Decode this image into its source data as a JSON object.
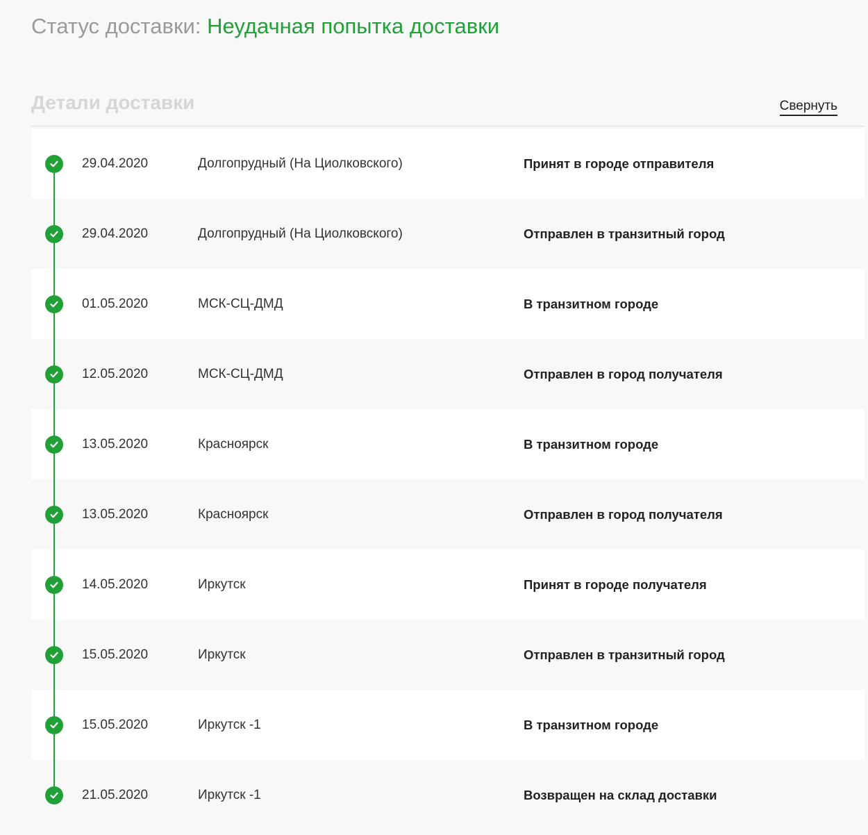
{
  "status": {
    "label": "Статус доставки:",
    "value": "Неудачная попытка доставки"
  },
  "details": {
    "title": "Детали доставки",
    "collapse_label": "Свернуть"
  },
  "timeline": [
    {
      "date": "29.04.2020",
      "place": "Долгопрудный (На Циолковского)",
      "event": "Принят в городе отправителя"
    },
    {
      "date": "29.04.2020",
      "place": "Долгопрудный (На Циолковского)",
      "event": "Отправлен в транзитный город"
    },
    {
      "date": "01.05.2020",
      "place": "МСК-СЦ-ДМД",
      "event": "В транзитном городе"
    },
    {
      "date": "12.05.2020",
      "place": "МСК-СЦ-ДМД",
      "event": "Отправлен в город получателя"
    },
    {
      "date": "13.05.2020",
      "place": "Красноярск",
      "event": "В транзитном городе"
    },
    {
      "date": "13.05.2020",
      "place": "Красноярск",
      "event": "Отправлен в город получателя"
    },
    {
      "date": "14.05.2020",
      "place": "Иркутск",
      "event": "Принят в городе получателя"
    },
    {
      "date": "15.05.2020",
      "place": "Иркутск",
      "event": "Отправлен в транзитный город"
    },
    {
      "date": "15.05.2020",
      "place": "Иркутск -1",
      "event": "В транзитном городе"
    },
    {
      "date": "21.05.2020",
      "place": "Иркутск -1",
      "event": "Возвращен на склад доставки"
    }
  ],
  "colors": {
    "accent": "#21a038",
    "muted_title": "#d6d6d6",
    "label_gray": "#9a9a9a"
  },
  "icons": {
    "step": "check-circle-icon"
  }
}
